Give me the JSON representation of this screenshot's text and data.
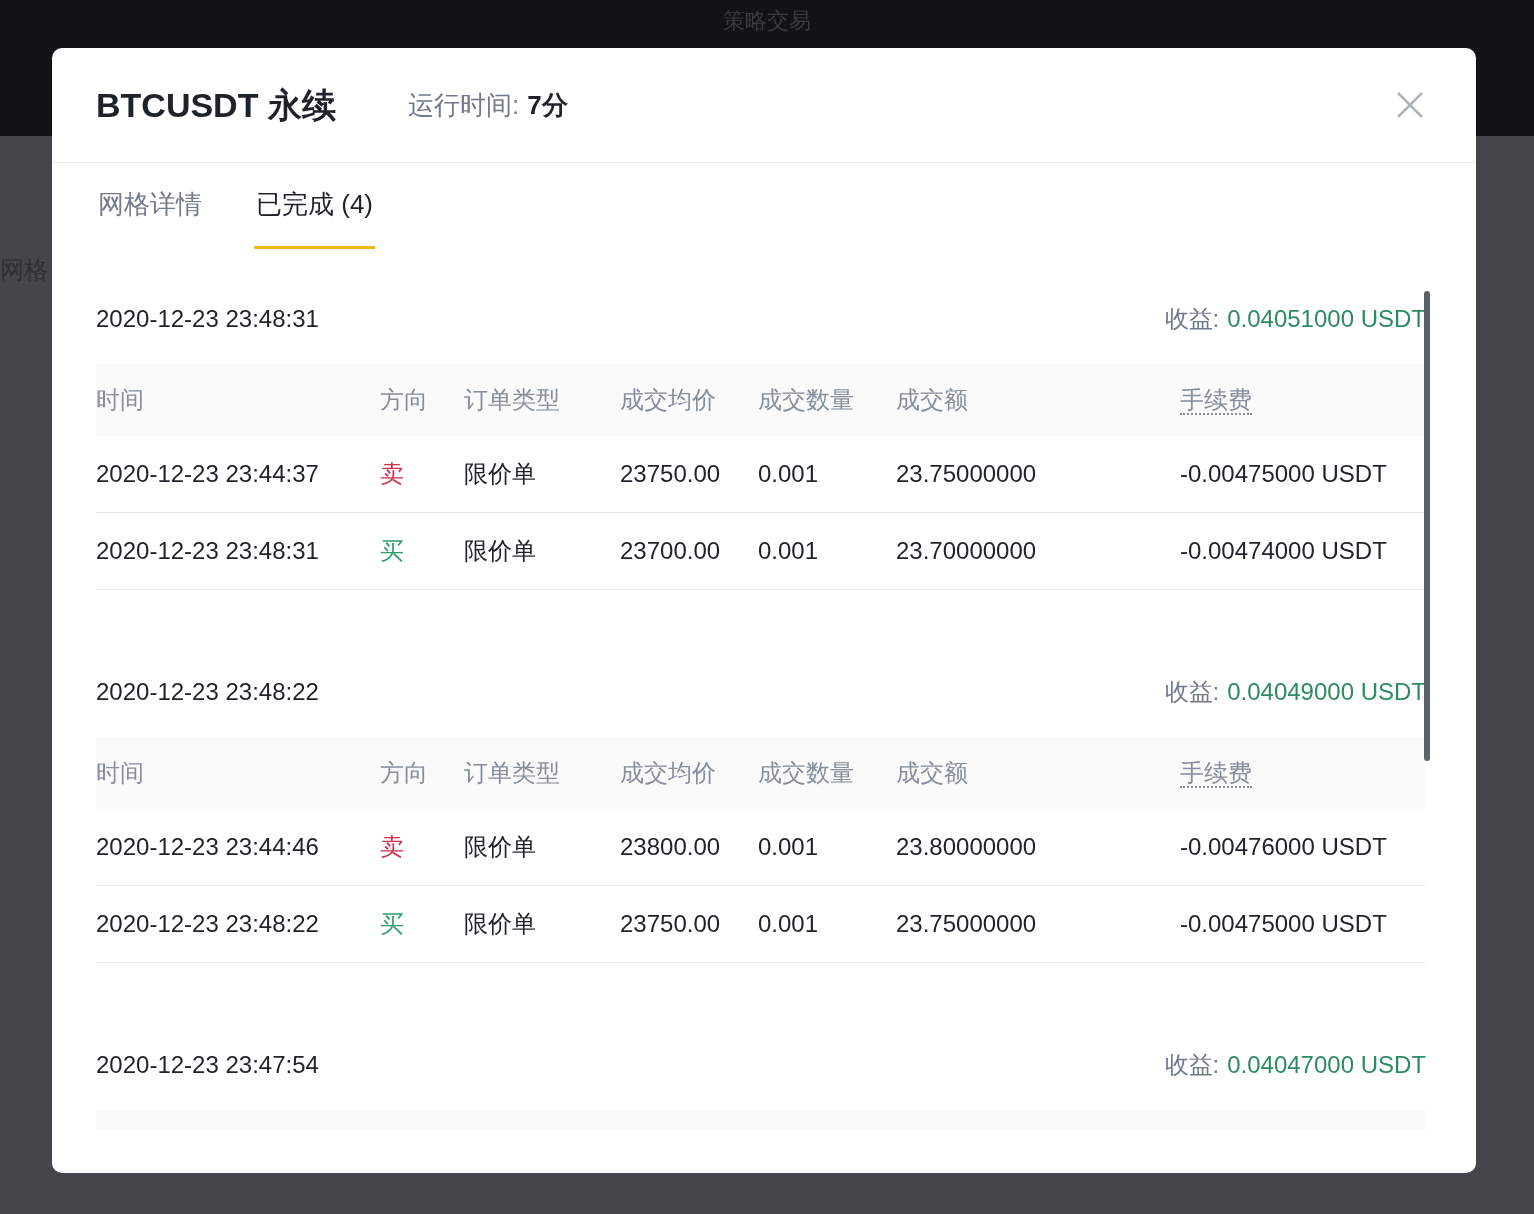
{
  "background": {
    "title": "策略交易",
    "side_text": "网格"
  },
  "modal": {
    "title": "BTCUSDT 永续",
    "runtime_label": "运行时间:",
    "runtime_value": "7分"
  },
  "tabs": [
    {
      "label": "网格详情",
      "selected": false
    },
    {
      "label": "已完成 (4)",
      "selected": true
    }
  ],
  "groups": [
    {
      "time": "2020-12-23 23:48:31",
      "profit_label": "收益:",
      "profit_value": "0.04051000 USDT",
      "columns": [
        "时间",
        "方向",
        "订单类型",
        "成交均价",
        "成交数量",
        "成交额",
        "手续费"
      ],
      "rows": [
        {
          "time": "2020-12-23 23:44:37",
          "side": "卖",
          "kind": "sell",
          "type": "限价单",
          "price": "23750.00",
          "qty": "0.001",
          "amount": "23.75000000",
          "fee": "-0.00475000 USDT"
        },
        {
          "time": "2020-12-23 23:48:31",
          "side": "买",
          "kind": "buy",
          "type": "限价单",
          "price": "23700.00",
          "qty": "0.001",
          "amount": "23.70000000",
          "fee": "-0.00474000 USDT"
        }
      ]
    },
    {
      "time": "2020-12-23 23:48:22",
      "profit_label": "收益:",
      "profit_value": "0.04049000 USDT",
      "columns": [
        "时间",
        "方向",
        "订单类型",
        "成交均价",
        "成交数量",
        "成交额",
        "手续费"
      ],
      "rows": [
        {
          "time": "2020-12-23 23:44:46",
          "side": "卖",
          "kind": "sell",
          "type": "限价单",
          "price": "23800.00",
          "qty": "0.001",
          "amount": "23.80000000",
          "fee": "-0.00476000 USDT"
        },
        {
          "time": "2020-12-23 23:48:22",
          "side": "买",
          "kind": "buy",
          "type": "限价单",
          "price": "23750.00",
          "qty": "0.001",
          "amount": "23.75000000",
          "fee": "-0.00475000 USDT"
        }
      ]
    },
    {
      "time": "2020-12-23 23:47:54",
      "profit_label": "收益:",
      "profit_value": "0.04047000 USDT"
    }
  ]
}
